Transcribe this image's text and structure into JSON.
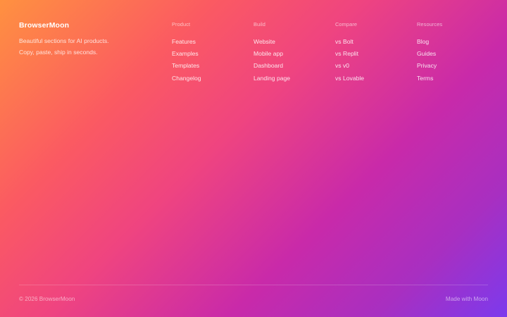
{
  "brand": {
    "name": "BrowserMoon",
    "tagline": "Beautiful sections for AI products. Copy, paste, ship in seconds."
  },
  "columns": [
    {
      "heading": "Product",
      "links": [
        "Features",
        "Examples",
        "Templates",
        "Changelog"
      ]
    },
    {
      "heading": "Build",
      "links": [
        "Website",
        "Mobile app",
        "Dashboard",
        "Landing page"
      ]
    },
    {
      "heading": "Compare",
      "links": [
        "vs Bolt",
        "vs Replit",
        "vs v0",
        "vs Lovable"
      ]
    },
    {
      "heading": "Resources",
      "links": [
        "Blog",
        "Guides",
        "Privacy",
        "Terms"
      ]
    }
  ],
  "bottom": {
    "copyright": "© 2026 BrowserMoon",
    "made_with": "Made with Moon"
  },
  "colors": {
    "gradient_start": "#ff9140",
    "gradient_mid": "#ef4480",
    "gradient_end": "#7c3aed",
    "text": "#ffffff"
  }
}
